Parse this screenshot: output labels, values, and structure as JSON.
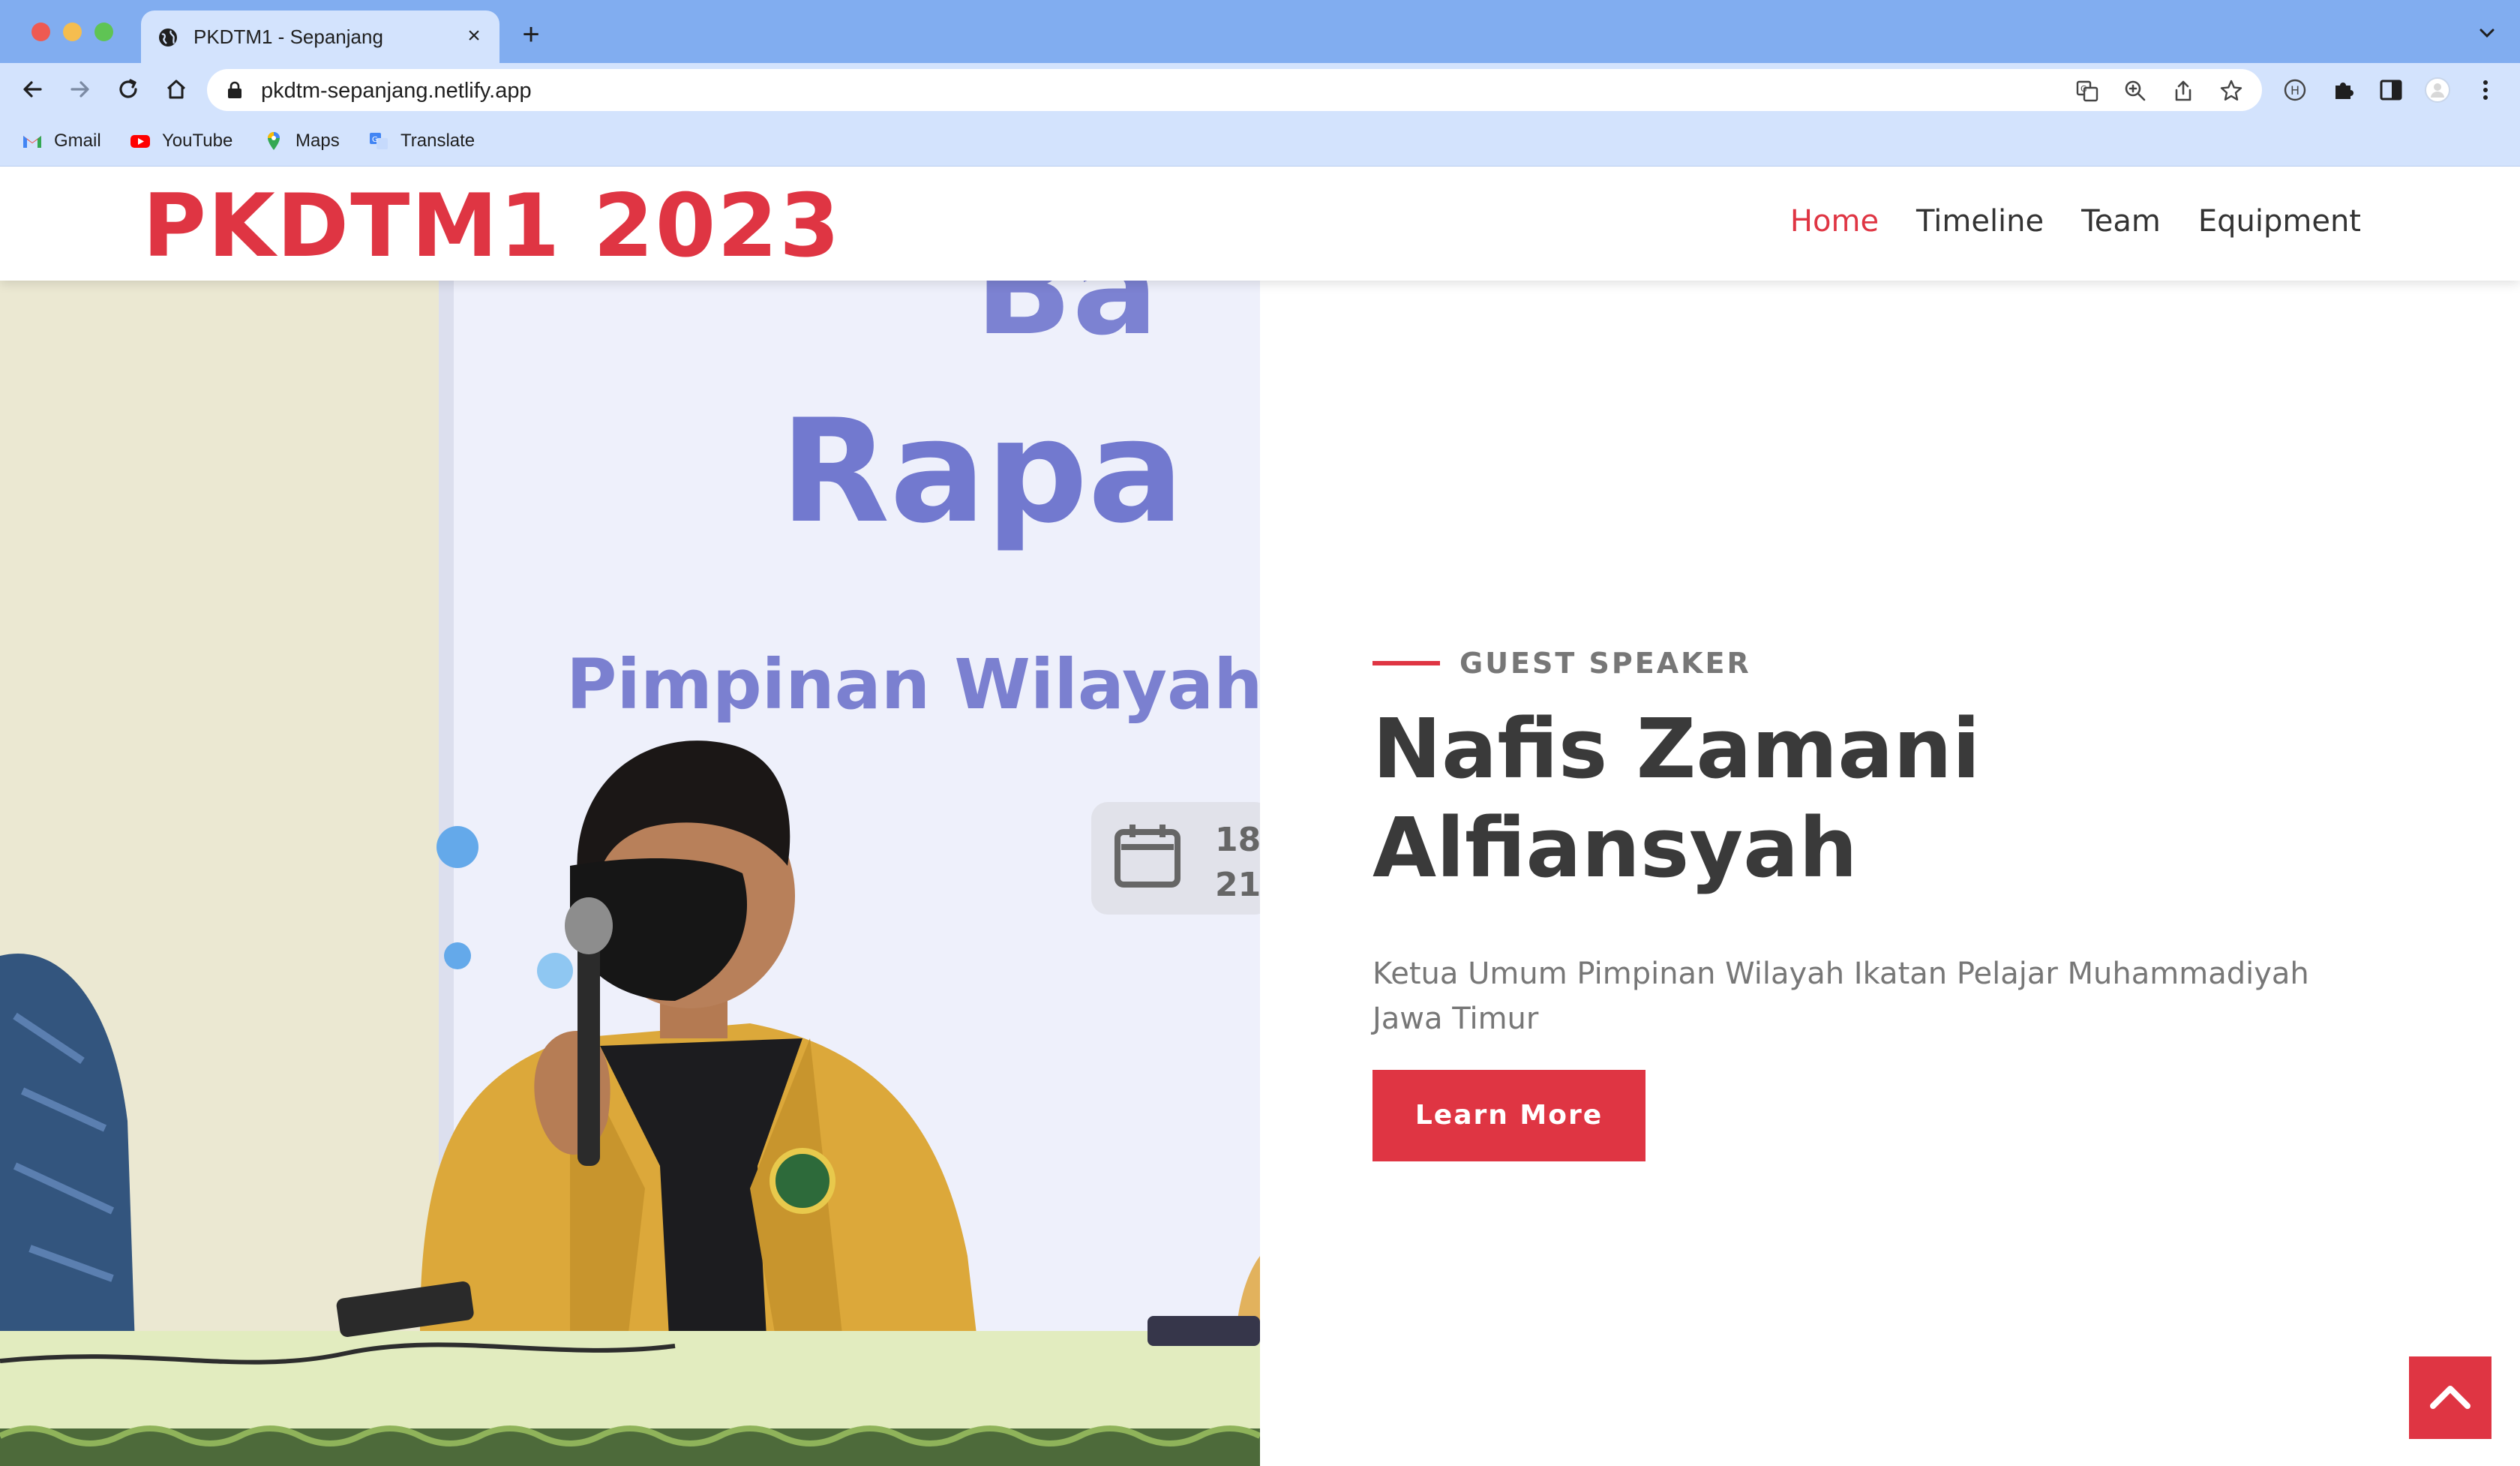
{
  "browser": {
    "tab_title": "PKDTM1 - Sepanjang",
    "tab_close": "×",
    "new_tab": "+",
    "url": "pkdtm-sepanjang.netlify.app",
    "bookmarks": [
      {
        "label": "Gmail",
        "icon": "gmail-icon"
      },
      {
        "label": "YouTube",
        "icon": "youtube-icon"
      },
      {
        "label": "Maps",
        "icon": "maps-icon"
      },
      {
        "label": "Translate",
        "icon": "translate-icon"
      }
    ]
  },
  "site": {
    "logo": "PKDTM1 2023",
    "nav": [
      {
        "label": "Home",
        "active": true
      },
      {
        "label": "Timeline",
        "active": false
      },
      {
        "label": "Team",
        "active": false
      },
      {
        "label": "Equipment",
        "active": false
      }
    ]
  },
  "hero": {
    "eyebrow": "GUEST SPEAKER",
    "name": "Nafis Zamani Alfiansyah",
    "role": "Ketua Umum Pimpinan Wilayah Ikatan Pelajar Muhammadiyah Jawa Timur",
    "cta": "Learn More",
    "photo_banner": {
      "line1": "Ba",
      "line2": "Rapa",
      "line3": "Pimpinan Wilayah",
      "date1": "18",
      "date2": "21"
    }
  },
  "colors": {
    "accent": "#df3543",
    "heading": "#3a3a3a",
    "muted": "#777777",
    "chrome_tabbar": "#81adf0",
    "chrome_toolbar": "#d3e3fd"
  }
}
